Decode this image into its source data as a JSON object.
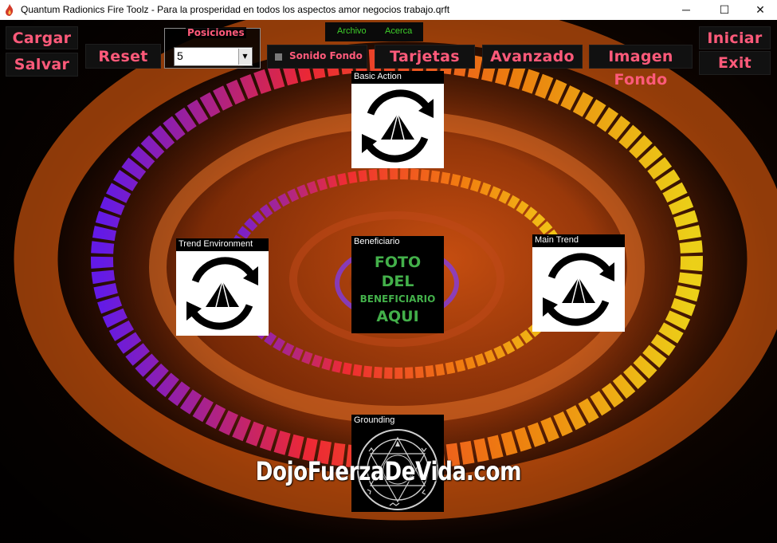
{
  "window": {
    "title": "Quantum Radionics Fire Toolz - Para la prosperidad en todos los aspectos amor negocios trabajo.qrft",
    "minimize": "─",
    "maximize": "☐",
    "close": "✕"
  },
  "menu": {
    "archivo": "Archivo",
    "acerca": "Acerca"
  },
  "buttons": {
    "cargar": "Cargar",
    "salvar": "Salvar",
    "reset": "Reset",
    "tarjetas": "Tarjetas Chi",
    "avanzado": "Avanzado",
    "imagen": "Imagen Fondo",
    "iniciar": "Iniciar",
    "exit": "Exit"
  },
  "posiciones": {
    "label": "Posiciones",
    "value": "5"
  },
  "sonido": {
    "label": "Sonido Fondo",
    "checked": false
  },
  "panels": {
    "basic": "Basic Action",
    "trend": "Trend Environment",
    "main": "Main Trend",
    "benef": "Beneficiario",
    "ground": "Grounding"
  },
  "beneficiary_photo": {
    "line1": "FOTO",
    "line2": "DEL",
    "line3": "BENEFICIARIO",
    "line4": "AQUI"
  },
  "watermark": "DojoFuerzaDeVida.com",
  "colors": {
    "button_text": "#ff5a7a",
    "menu_text": "#3ecf2a",
    "photo_text": "#43b04a"
  },
  "icons": {
    "panel_symbol": "cycle-pyramid-icon",
    "grounding_symbol": "seal-icon"
  }
}
